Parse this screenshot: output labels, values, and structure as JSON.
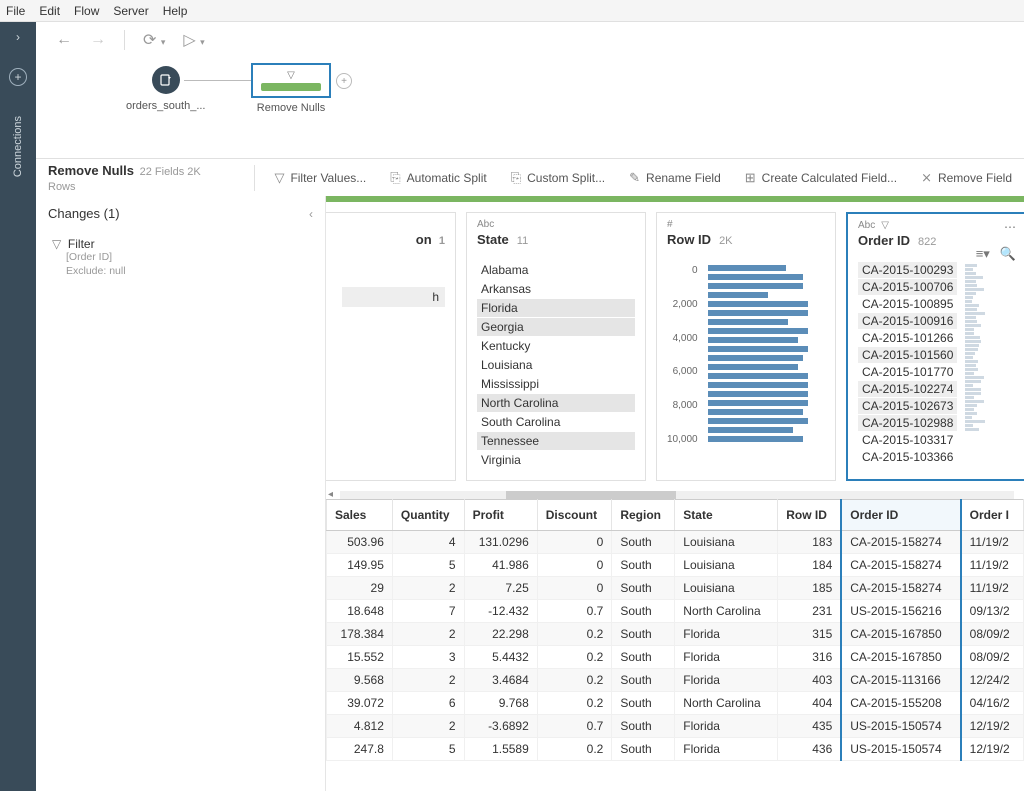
{
  "menu": {
    "file": "File",
    "edit": "Edit",
    "flow": "Flow",
    "server": "Server",
    "help": "Help"
  },
  "sidebar": {
    "connections": "Connections"
  },
  "flow": {
    "input_label": "orders_south_...",
    "step_label": "Remove Nulls"
  },
  "ribbon": {
    "title": "Remove Nulls",
    "subtitle": "22 Fields  2K Rows",
    "filter_values": "Filter Values...",
    "automatic_split": "Automatic Split",
    "custom_split": "Custom Split...",
    "rename_field": "Rename Field",
    "create_calc": "Create Calculated Field...",
    "remove_field": "Remove Field"
  },
  "changes": {
    "header": "Changes (1)",
    "filter_label": "Filter",
    "filter_field": "[Order ID]",
    "filter_rule": "Exclude: null"
  },
  "cards": {
    "partial": {
      "count": "1",
      "suffix": "on",
      "val": "h"
    },
    "state": {
      "type": "Abc",
      "name": "State",
      "count": "11",
      "items": [
        "Alabama",
        "Arkansas",
        "Florida",
        "Georgia",
        "Kentucky",
        "Louisiana",
        "Mississippi",
        "North Carolina",
        "South Carolina",
        "Tennessee",
        "Virginia"
      ],
      "highlights": [
        2,
        3,
        7,
        9
      ]
    },
    "rowid": {
      "type": "#",
      "name": "Row ID",
      "count": "2K",
      "ylabels": [
        "0",
        "2,000",
        "4,000",
        "6,000",
        "8,000",
        "10,000"
      ]
    },
    "orderid": {
      "type": "Abc",
      "name": "Order ID",
      "count": "822",
      "values": [
        "CA-2015-100293",
        "CA-2015-100706",
        "CA-2015-100895",
        "CA-2015-100916",
        "CA-2015-101266",
        "CA-2015-101560",
        "CA-2015-101770",
        "CA-2015-102274",
        "CA-2015-102673",
        "CA-2015-102988",
        "CA-2015-103317",
        "CA-2015-103366"
      ],
      "highlights": [
        0,
        1,
        3,
        5,
        7,
        8,
        9
      ]
    }
  },
  "grid": {
    "headers": [
      "Sales",
      "Quantity",
      "Profit",
      "Discount",
      "Region",
      "State",
      "Row ID",
      "Order ID",
      "Order I"
    ],
    "rows": [
      [
        "503.96",
        "4",
        "131.0296",
        "0",
        "South",
        "Louisiana",
        "183",
        "CA-2015-158274",
        "11/19/2"
      ],
      [
        "149.95",
        "5",
        "41.986",
        "0",
        "South",
        "Louisiana",
        "184",
        "CA-2015-158274",
        "11/19/2"
      ],
      [
        "29",
        "2",
        "7.25",
        "0",
        "South",
        "Louisiana",
        "185",
        "CA-2015-158274",
        "11/19/2"
      ],
      [
        "18.648",
        "7",
        "-12.432",
        "0.7",
        "South",
        "North Carolina",
        "231",
        "US-2015-156216",
        "09/13/2"
      ],
      [
        "178.384",
        "2",
        "22.298",
        "0.2",
        "South",
        "Florida",
        "315",
        "CA-2015-167850",
        "08/09/2"
      ],
      [
        "15.552",
        "3",
        "5.4432",
        "0.2",
        "South",
        "Florida",
        "316",
        "CA-2015-167850",
        "08/09/2"
      ],
      [
        "9.568",
        "2",
        "3.4684",
        "0.2",
        "South",
        "Florida",
        "403",
        "CA-2015-113166",
        "12/24/2"
      ],
      [
        "39.072",
        "6",
        "9.768",
        "0.2",
        "South",
        "North Carolina",
        "404",
        "CA-2015-155208",
        "04/16/2"
      ],
      [
        "4.812",
        "2",
        "-3.6892",
        "0.7",
        "South",
        "Florida",
        "435",
        "US-2015-150574",
        "12/19/2"
      ],
      [
        "247.8",
        "5",
        "1.5589",
        "0.2",
        "South",
        "Florida",
        "436",
        "US-2015-150574",
        "12/19/2"
      ]
    ]
  },
  "chart_data": {
    "type": "bar",
    "title": "Row ID",
    "orientation": "horizontal",
    "ylim": [
      0,
      10000
    ],
    "tick_labels": [
      "0",
      "2,000",
      "4,000",
      "6,000",
      "8,000",
      "10,000"
    ],
    "note": "Bar lengths estimated from pixel widths; each row represents a bin count",
    "values": [
      78,
      95,
      95,
      60,
      100,
      100,
      80,
      100,
      90,
      100,
      95,
      90,
      100,
      100,
      100,
      100,
      95,
      100,
      85,
      95
    ]
  }
}
